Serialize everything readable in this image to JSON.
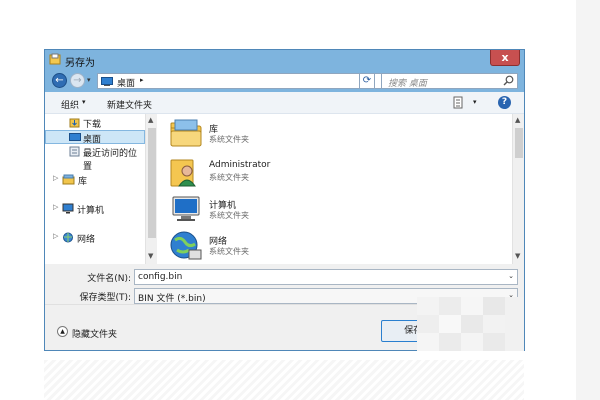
{
  "window": {
    "title": "另存为",
    "close_label": "x"
  },
  "nav": {
    "back_glyph": "←",
    "forward_glyph": "→",
    "address": "桌面",
    "search_placeholder": "搜索 桌面"
  },
  "toolbar": {
    "organize": "组织",
    "new_folder": "新建文件夹",
    "help": "?"
  },
  "sidebar": {
    "items": [
      {
        "label": "下载"
      },
      {
        "label": "桌面"
      },
      {
        "label": "最近访问的位置"
      },
      {
        "label": "库"
      },
      {
        "label": "计算机"
      },
      {
        "label": "网络"
      }
    ]
  },
  "files": [
    {
      "name": "库",
      "type": "系统文件夹",
      "icon": "library-folder-icon"
    },
    {
      "name": "Administrator",
      "type": "系统文件夹",
      "icon": "user-folder-icon"
    },
    {
      "name": "计算机",
      "type": "系统文件夹",
      "icon": "computer-icon"
    },
    {
      "name": "网络",
      "type": "系统文件夹",
      "icon": "network-globe-icon"
    }
  ],
  "form": {
    "filename_label": "文件名(N):",
    "filename_value": "config.bin",
    "filetype_label": "保存类型(T):",
    "filetype_value": "BIN 文件 (*.bin)"
  },
  "footer": {
    "hide_folders": "隐藏文件夹",
    "save_button": "保存("
  },
  "colors": {
    "frame": "#7eb4de",
    "selection": "#cde6f7",
    "close": "#c75050"
  }
}
